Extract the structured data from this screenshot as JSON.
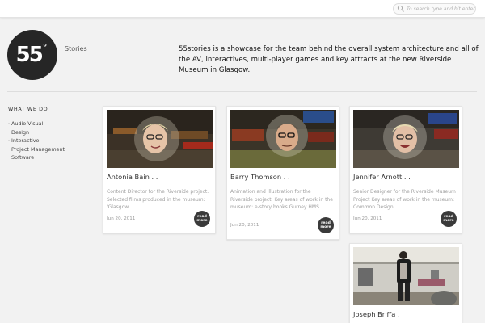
{
  "search": {
    "placeholder": "To search type and hit enter",
    "value": ""
  },
  "header": {
    "logo_text": "55",
    "logo_mark": "°",
    "site_name": "Stories",
    "tagline": "55stories is a showcase for the team behind the overall system architecture and all of the AV, interactives, multi-player games and key attracts at the new Riverside Museum in Glasgow."
  },
  "sidebar": {
    "heading": "WHAT WE DO",
    "items": [
      {
        "label": "Audio Visual"
      },
      {
        "label": "Design"
      },
      {
        "label": "Interactive"
      },
      {
        "label": "Project Management"
      },
      {
        "label": "Software"
      }
    ]
  },
  "cards": [
    {
      "name": "Antonia Bain . .",
      "desc": "Content Director for the Riverside project. Selected films produced in the museum: 'Glasgow ...",
      "date": "Jun 20, 2011",
      "read_more": "read more",
      "image_alt": "photo-woman-in-helmet"
    },
    {
      "name": "Barry Thomson . .",
      "desc": "Animation and illustration for the Riverside project. Key areas of work in the museum: e-story books Gurney HMS ...",
      "date": "Jun 20, 2011",
      "read_more": "read more",
      "image_alt": "photo-man-in-helmet"
    },
    {
      "name": "Jennifer Arnott . .",
      "desc": "Senior Designer for the Riverside Museum Project Key areas of work in the museum: Common Design ...",
      "date": "Jun 20, 2011",
      "read_more": "read more",
      "image_alt": "photo-woman-laughing-in-helmet"
    },
    {
      "name": "Joseph Briffa . .",
      "desc": "",
      "date": "",
      "read_more": "",
      "image_alt": "photo-man-standing-in-hall"
    }
  ],
  "colors": {
    "background": "#f2f2f2",
    "logo": "#262626",
    "read_more": "#3a3a3a",
    "muted_text": "#a0a0a0"
  }
}
